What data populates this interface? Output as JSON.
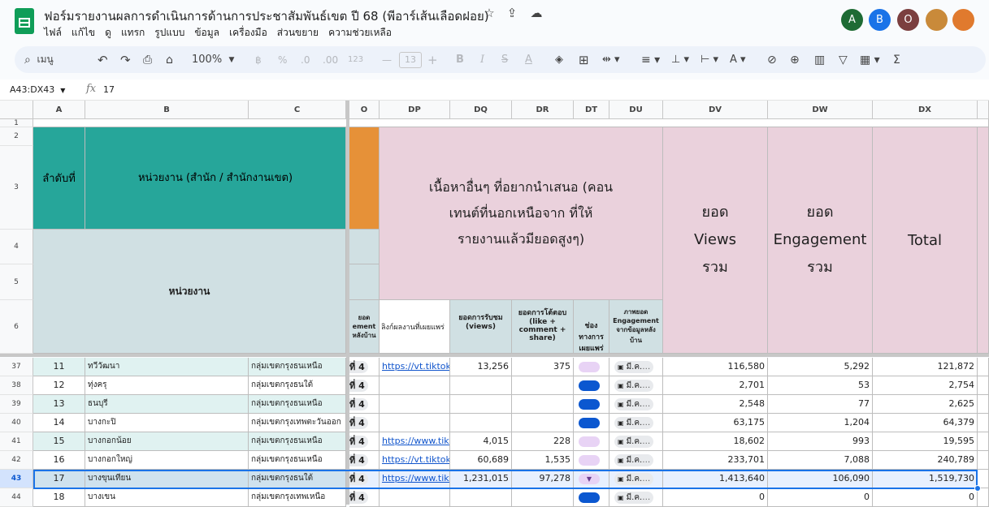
{
  "app": {
    "title": "ฟอร์มรายงานผลการดำเนินการด้านการประชาสัมพันธ์เขต ปี 68 (พีอาร์เส้นเลือดฝอย)",
    "menu": [
      "ไฟล์",
      "แก้ไข",
      "ดู",
      "แทรก",
      "รูปแบบ",
      "ข้อมูล",
      "เครื่องมือ",
      "ส่วนขยาย",
      "ความช่วยเหลือ"
    ],
    "avatars": [
      {
        "label": "A",
        "color": "#1e6b34"
      },
      {
        "label": "B",
        "color": "#1a73e8"
      },
      {
        "label": "O",
        "color": "#7b3f3f"
      },
      {
        "label": "",
        "color": "#c98a3a"
      },
      {
        "label": "",
        "color": "#e07a2e"
      }
    ]
  },
  "toolbar": {
    "search": "เมนู",
    "zoom": "100%",
    "font_size": "13",
    "currency": "฿",
    "percent": "%",
    "dec_down": ".0",
    "dec_up": ".00",
    "fmt": "123"
  },
  "formula": {
    "namebox": "A43:DX43",
    "fx": "fx",
    "value": "17"
  },
  "columns": [
    "A",
    "B",
    "C",
    "O",
    "DP",
    "DQ",
    "DR",
    "DT",
    "DU",
    "DV",
    "DW",
    "DX"
  ],
  "headers": {
    "seq": "ลำดับที่",
    "unit": "หน่วยงาน (สำนัก / สำนักงานเขต)",
    "unit_sub": "หน่วยงาน",
    "o_partial": "ยอด ement หลังบ้าน",
    "content": "เนื้อหาอื่นๆ ที่อยากนำเสนอ (คอนเทนต์ที่นอกเหนือจาก ที่ให้รายงานแล้วมียอดสูงๆ)",
    "link": "ลิงก์ผลงานที่เผยแพร่",
    "views": "ยอดการรับชม (views)",
    "engage": "ยอดการโต้ตอบ (like + comment + share)",
    "channel": "ช่องทางการเผยแพร่",
    "backend": "ภาพยอด Engagement จากข้อมูลหลังบ้าน",
    "total_views": "ยอด Views รวม",
    "total_engage": "ยอด Engagement รวม",
    "total": "Total"
  },
  "header_rows": [
    "1",
    "2",
    "3",
    "4",
    "5",
    "6"
  ],
  "rows": [
    {
      "r": "37",
      "seq": "11",
      "name": "ทวีวัฒนา",
      "group": "กลุ่มเขตกรุงธนเหนือ",
      "o": "ที่ 4",
      "link": "https://vt.tiktok.c",
      "views": "13,256",
      "eng": "375",
      "chip": "lav",
      "du": "มี.ค.",
      "dv": "116,580",
      "dw": "5,292",
      "dx": "121,872"
    },
    {
      "r": "38",
      "seq": "12",
      "name": "ทุ่งครุ",
      "group": "กลุ่มเขตกรุงธนใต้",
      "o": "ที่ 4",
      "link": "",
      "views": "",
      "eng": "",
      "chip": "blue",
      "du": "มี.ค.",
      "dv": "2,701",
      "dw": "53",
      "dx": "2,754"
    },
    {
      "r": "39",
      "seq": "13",
      "name": "ธนบุรี",
      "group": "กลุ่มเขตกรุงธนเหนือ",
      "o": "ที่ 4",
      "link": "",
      "views": "",
      "eng": "",
      "chip": "blue",
      "du": "มี.ค.",
      "dv": "2,548",
      "dw": "77",
      "dx": "2,625"
    },
    {
      "r": "40",
      "seq": "14",
      "name": "บางกะปิ",
      "group": "กลุ่มเขตกรุงเทพตะวันออก",
      "o": "ที่ 4",
      "link": "",
      "views": "",
      "eng": "",
      "chip": "blue",
      "du": "มี.ค.",
      "dv": "63,175",
      "dw": "1,204",
      "dx": "64,379"
    },
    {
      "r": "41",
      "seq": "15",
      "name": "บางกอกน้อย",
      "group": "กลุ่มเขตกรุงธนเหนือ",
      "o": "ที่ 4",
      "link": "https://www.tiktc",
      "views": "4,015",
      "eng": "228",
      "chip": "lav",
      "du": "มี.ค.",
      "dv": "18,602",
      "dw": "993",
      "dx": "19,595"
    },
    {
      "r": "42",
      "seq": "16",
      "name": "บางกอกใหญ่",
      "group": "กลุ่มเขตกรุงธนเหนือ",
      "o": "ที่ 4",
      "link": "https://vt.tiktok.c",
      "views": "60,689",
      "eng": "1,535",
      "chip": "lav",
      "du": "มี.ค.",
      "dv": "233,701",
      "dw": "7,088",
      "dx": "240,789"
    },
    {
      "r": "43",
      "seq": "17",
      "name": "บางขุนเทียน",
      "group": "กลุ่มเขตกรุงธนใต้",
      "o": "ที่ 4",
      "link": "https://www.tiktc",
      "views": "1,231,015",
      "eng": "97,278",
      "chip": "lav",
      "du": "มี.ค.",
      "dv": "1,413,640",
      "dw": "106,090",
      "dx": "1,519,730"
    },
    {
      "r": "44",
      "seq": "18",
      "name": "บางเขน",
      "group": "กลุ่มเขตกรุงเทพเหนือ",
      "o": "ที่ 4",
      "link": "",
      "views": "",
      "eng": "",
      "chip": "blue",
      "du": "มี.ค.",
      "dv": "0",
      "dw": "0",
      "dx": "0"
    }
  ]
}
